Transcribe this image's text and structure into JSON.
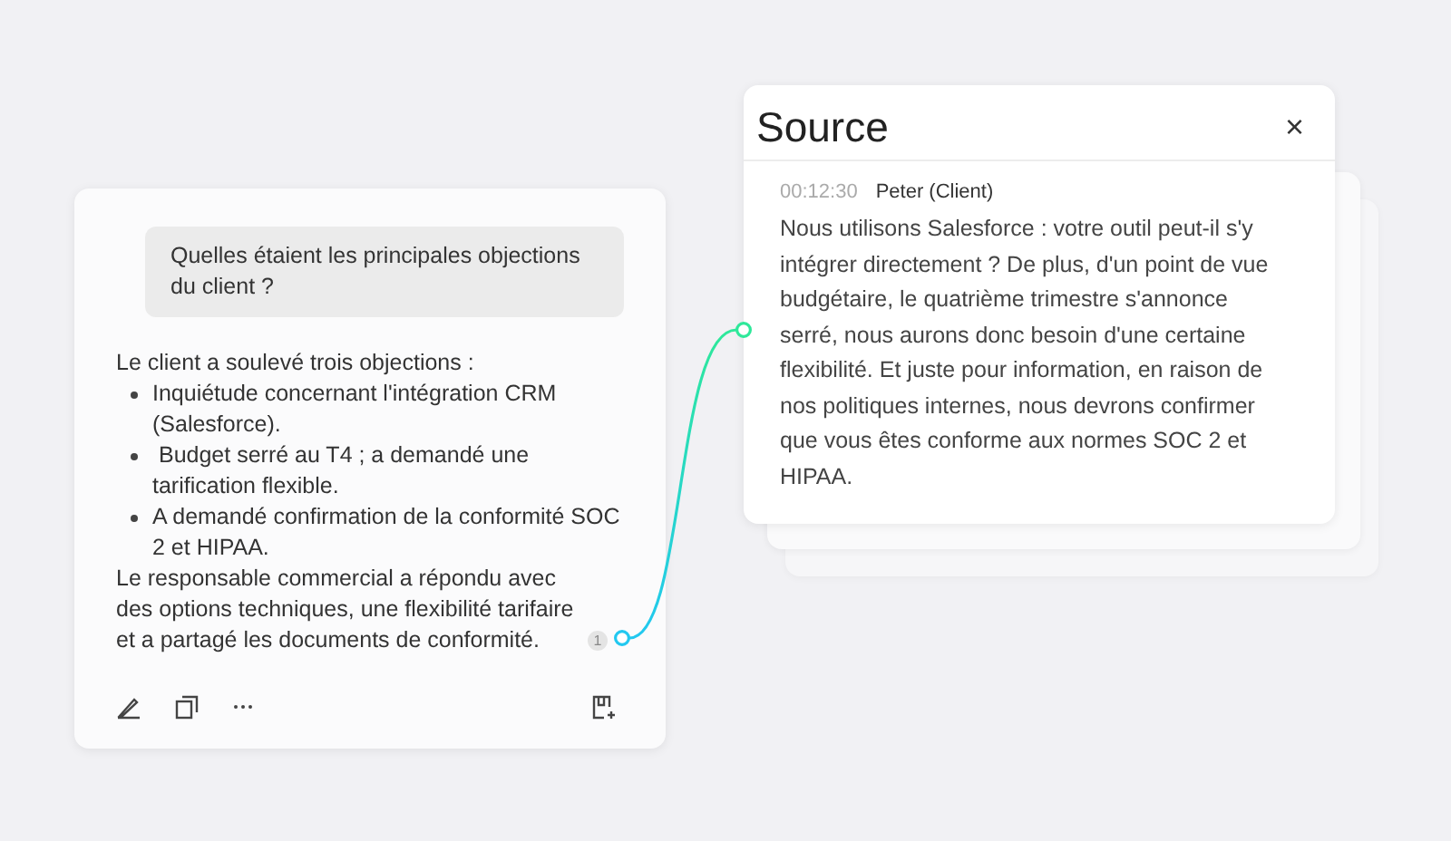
{
  "chat_card": {
    "question": "Quelles étaient les principales objections du client ?",
    "answer_intro": "Le client a soulevé trois objections :",
    "bullets": [
      "Inquiétude concernant l'intégration CRM (Salesforce).",
      " Budget serré au T4 ; a demandé une tarification flexible.",
      "A demandé confirmation de la conformité SOC 2 et HIPAA."
    ],
    "conclusion": "Le responsable commercial a répondu avec des options techniques, une flexibilité tarifaire et a partagé les documents de conformité.",
    "citation": "1"
  },
  "source_panel": {
    "title": "Source",
    "close": "×",
    "timestamp": "00:12:30",
    "speaker": "Peter (Client)",
    "text": "Nous utilisons Salesforce : votre outil peut-il s'y intégrer directement ? De plus, d'un point de vue budgétaire, le quatrième trimestre s'annonce serré, nous aurons donc besoin d'une certaine flexibilité. Et juste pour information, en raison de nos politiques internes, nous devrons confirmer que vous êtes conforme aux normes SOC 2 et HIPAA."
  }
}
